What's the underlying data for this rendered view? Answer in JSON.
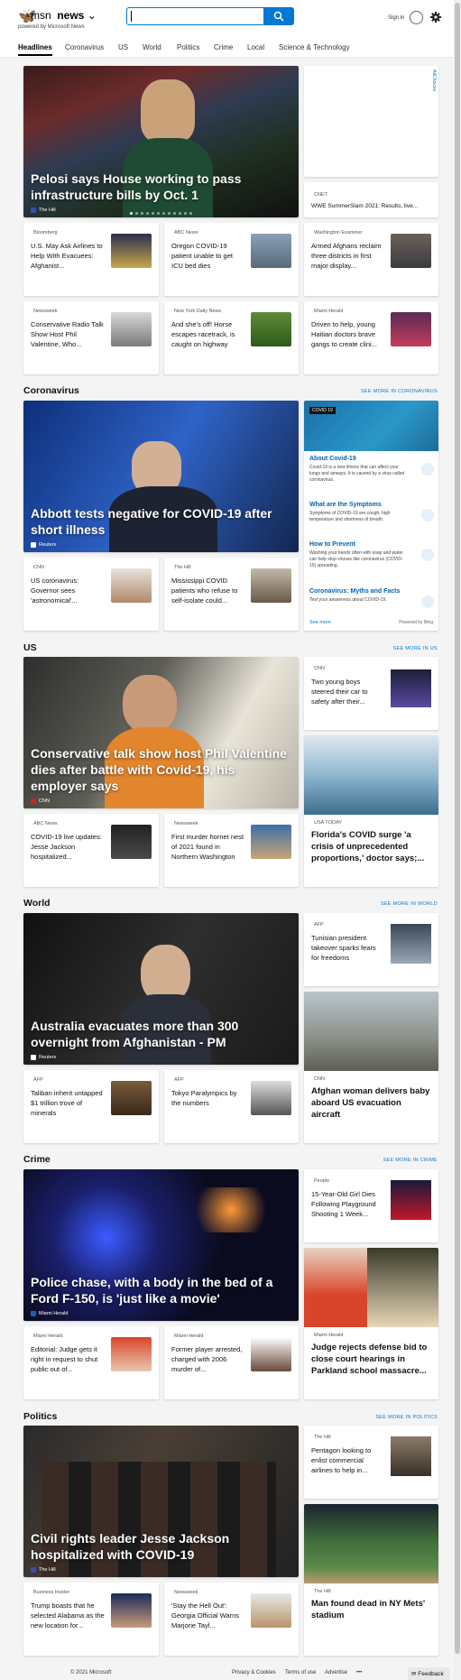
{
  "header": {
    "brand": "msn",
    "product": "news",
    "powered": "powered by Microsoft News",
    "signin": "Sign in",
    "search_placeholder": ""
  },
  "nav": [
    "Headlines",
    "Coronavirus",
    "US",
    "World",
    "Politics",
    "Crime",
    "Local",
    "Science & Technology"
  ],
  "ad": {
    "label": "AdChoices"
  },
  "top": {
    "hero": {
      "title": "Pelosi says House working to pass infrastructure bills by Oct. 1",
      "source": "The Hill"
    },
    "side": {
      "source": "CNET",
      "title": "WWE SummerSlam 2021: Results, live..."
    },
    "row1": [
      {
        "source": "Bloomberg",
        "title": "U.S. May Ask Airlines to Help With Evacuees: Afghanist..."
      },
      {
        "source": "ABC News",
        "title": "Oregon COVID-19 patient unable to get ICU bed dies"
      },
      {
        "source": "Washington Examiner",
        "title": "Armed Afghans reclaim three districts in first major display..."
      }
    ],
    "row2": [
      {
        "source": "Newsweek",
        "title": "Conservative Radio Talk Show Host Phil Valentine, Who..."
      },
      {
        "source": "New York Daily News",
        "title": "And she's off! Horse escapes racetrack, is caught on highway"
      },
      {
        "source": "Miami Herald",
        "title": "Driven to help, young Haitian doctors brave gangs to create clini..."
      }
    ]
  },
  "coronavirus": {
    "heading": "Coronavirus",
    "more": "SEE MORE IN CORONAVIRUS",
    "hero": {
      "title": "Abbott tests negative for COVID-19 after short illness",
      "source": "Reuters"
    },
    "row": [
      {
        "source": "CNN",
        "title": "US coronavirus: Governor sees 'astronomical'..."
      },
      {
        "source": "The Hill",
        "title": "Mississippi COVID patients who refuse to self-isolate could..."
      }
    ],
    "panel": {
      "label": "COVID 19",
      "items": [
        {
          "h": "About Covid-19",
          "d": "Covid-19 is a new illness that can affect your lungs and airways. It is caused by a virus called coronavirus."
        },
        {
          "h": "What are the Symptoms",
          "d": "Symptoms of COVID-19 are cough, high temperature and shortness of breath."
        },
        {
          "h": "How to Prevent",
          "d": "Washing your hands often with soap and water can help stop viruses like coronavirus (COVID-19) spreading."
        },
        {
          "h": "Coronavirus: Myths and Facts",
          "d": "Test your awareness about COVID-19."
        }
      ],
      "see_more": "See more",
      "powered": "Powered by Bing"
    }
  },
  "us": {
    "heading": "US",
    "more": "SEE MORE IN US",
    "hero": {
      "title": "Conservative talk show host Phil Valentine dies after battle with Covid-19, his employer says",
      "source": "CNN"
    },
    "side": {
      "source": "CNN",
      "title": "Two young boys steered their car to safety after their..."
    },
    "big": {
      "source": "USA TODAY",
      "title": "Florida's COVID surge 'a crisis of unprecedented proportions,' doctor says;..."
    },
    "row": [
      {
        "source": "ABC News",
        "title": "COVID-19 live updates: Jesse Jackson hospitalized..."
      },
      {
        "source": "Newsweek",
        "title": "First murder hornet nest of 2021 found in Northern Washington"
      }
    ]
  },
  "world": {
    "heading": "World",
    "more": "SEE MORE IN WORLD",
    "hero": {
      "title": "Australia evacuates more than 300 overnight from Afghanistan - PM",
      "source": "Reuters"
    },
    "side": {
      "source": "AFP",
      "title": "Tunisian president takeover sparks fears for freedoms"
    },
    "big": {
      "source": "CNN",
      "title": "Afghan woman delivers baby aboard US evacuation aircraft"
    },
    "row": [
      {
        "source": "AFP",
        "title": "Taliban inherit untapped $1 trillion trove of minerals"
      },
      {
        "source": "AFP",
        "title": "Tokyo Paralympics by the numbers"
      }
    ]
  },
  "crime": {
    "heading": "Crime",
    "more": "SEE MORE IN CRIME",
    "hero": {
      "title": "Police chase, with a body in the bed of a Ford F-150, is 'just like a movie'",
      "source": "Miami Herald"
    },
    "side": {
      "source": "People",
      "title": "15-Year-Old Girl Dies Following Playground Shooting 1 Week..."
    },
    "big": {
      "source": "Miami Herald",
      "title": "Judge rejects defense bid to close court hearings in Parkland school massacre..."
    },
    "row": [
      {
        "source": "Miami Herald",
        "title": "Editorial: Judge gets it right in request to shut public out of..."
      },
      {
        "source": "Miami Herald",
        "title": "Former player arrested, charged with 2006 murder of..."
      }
    ]
  },
  "politics": {
    "heading": "Politics",
    "more": "SEE MORE IN POLITICS",
    "hero": {
      "title": "Civil rights leader Jesse Jackson hospitalized with COVID-19",
      "source": "The Hill"
    },
    "side": {
      "source": "The Hill",
      "title": "Pentagon looking to enlist commercial airlines to help in..."
    },
    "big": {
      "source": "The Hill",
      "title": "Man found dead in NY Mets' stadium"
    },
    "row": [
      {
        "source": "Business Insider",
        "title": "Trump boasts that he selected Alabama as the new location for..."
      },
      {
        "source": "Newsweek",
        "title": "'Stay the Hell Out': Georgia Official Warns Marjorie Tayl..."
      }
    ]
  },
  "footer": {
    "copyright": "© 2021 Microsoft",
    "privacy": "Privacy & Cookies",
    "terms": "Terms of use",
    "advertise": "Advertise",
    "more": "•••",
    "feedback": "Feedback"
  }
}
